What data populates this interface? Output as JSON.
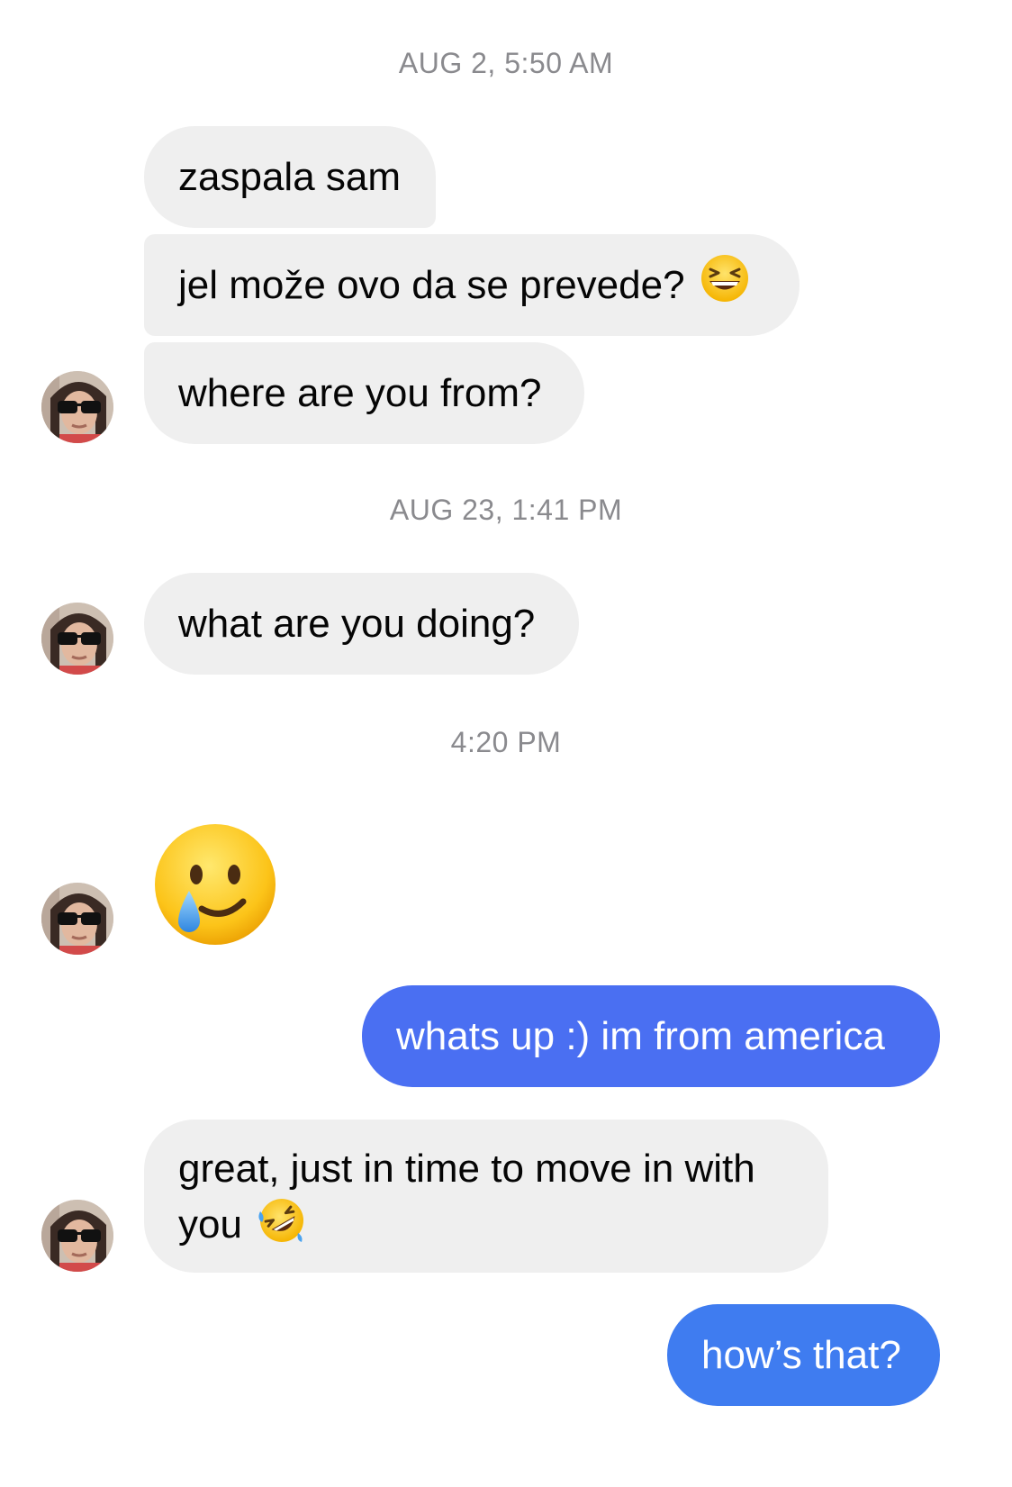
{
  "timestamps": {
    "t1": "AUG 2, 5:50 AM",
    "t2": "AUG 23, 1:41 PM",
    "t3": "4:20 PM"
  },
  "messages": {
    "m1": "zaspala sam",
    "m2": "jel može ovo da se prevede?",
    "m3": "where are you from?",
    "m4": "what are you doing?",
    "m6": "whats up :) im from america",
    "m7": "great, just in time to move in with you",
    "m8": "how’s that?"
  },
  "icons": {
    "m2_emoji": "grinning-squinting-face-icon",
    "m5_emoji": "smiling-face-with-tear-icon",
    "m7_emoji": "rolling-on-floor-laughing-icon",
    "avatar": "contact-avatar"
  },
  "colors": {
    "incoming_bubble": "#efefef",
    "outgoing_bubble": "#4a6ff2",
    "timestamp": "#8a8a8e"
  }
}
